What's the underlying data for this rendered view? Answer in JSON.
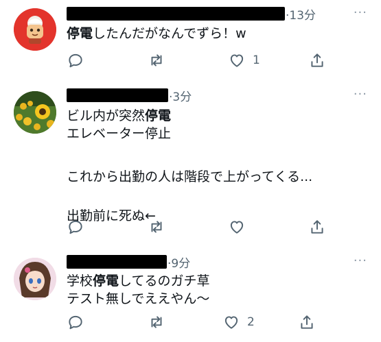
{
  "tweets": [
    {
      "time": "·13分",
      "text_parts": [
        {
          "bold": "停電",
          "rest": "したんだがなんでずら！w"
        }
      ],
      "reply_count": "",
      "retweet_count": "",
      "like_count": "1"
    },
    {
      "time": "·3分",
      "lines": [
        {
          "pre": "ビル内が突然",
          "bold": "停電",
          "post": ""
        },
        {
          "pre": "エレベーター停止",
          "bold": "",
          "post": ""
        },
        {
          "pre": "",
          "bold": "",
          "post": ""
        },
        {
          "pre": "これから出勤の人は階段で上がってくる...",
          "bold": "",
          "post": ""
        },
        {
          "pre": "",
          "bold": "",
          "post": ""
        },
        {
          "pre": "出勤前に死ぬ←",
          "bold": "",
          "post": ""
        }
      ],
      "reply_count": "",
      "retweet_count": "",
      "like_count": ""
    },
    {
      "time": "·9分",
      "lines": [
        {
          "pre": "学校",
          "bold": "停電",
          "post": "してるのガチ草"
        },
        {
          "pre": "テスト無しでええやん〜",
          "bold": "",
          "post": ""
        }
      ],
      "reply_count": "",
      "retweet_count": "",
      "like_count": "2"
    }
  ],
  "more_label": "···",
  "icon_color": "#536471"
}
